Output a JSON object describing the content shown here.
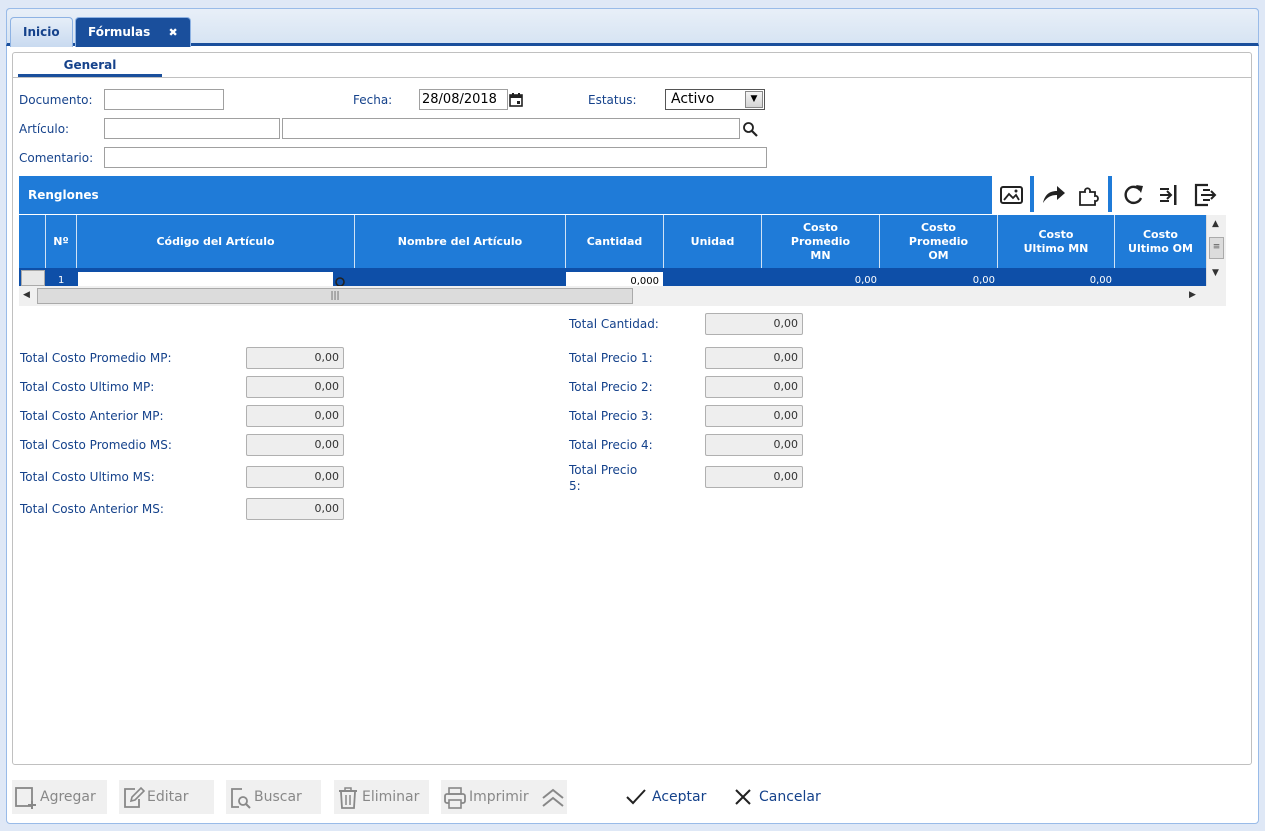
{
  "tabs": [
    {
      "label": "Inicio"
    },
    {
      "label": "Fórmulas",
      "close": "✖"
    }
  ],
  "subtab": {
    "label": "General"
  },
  "form": {
    "documento_label": "Documento:",
    "documento_value": "",
    "fecha_label": "Fecha:",
    "fecha_value": "28/08/2018",
    "estatus_label": "Estatus:",
    "estatus_value": "Activo",
    "articulo_label": "Artículo:",
    "articulo_code": "",
    "articulo_name": "",
    "comentario_label": "Comentario:",
    "comentario_value": ""
  },
  "renglones": {
    "title": "Renglones",
    "columns": [
      "Nº",
      "Código del Artículo",
      "Nombre del Artículo",
      "Cantidad",
      "Unidad",
      "Costo\nPromedio\nMN",
      "Costo\nPromedio\nOM",
      "Costo\nUltimo MN",
      "Costo\nUltimo OM"
    ],
    "row": {
      "num": "1",
      "cantidad": "0,000",
      "costo_prom_mn": "0,00",
      "costo_prom_om": "0,00",
      "costo_ult_mn": "0,00"
    }
  },
  "totals_left": [
    {
      "label": "Total Costo Promedio MP:",
      "value": "0,00"
    },
    {
      "label": "Total Costo Ultimo MP:",
      "value": "0,00"
    },
    {
      "label": "Total Costo Anterior MP:",
      "value": "0,00"
    },
    {
      "label": "Total Costo Promedio MS:",
      "value": "0,00"
    },
    {
      "label": "Total Costo Ultimo MS:",
      "value": "0,00"
    },
    {
      "label": "Total Costo Anterior MS:",
      "value": "0,00"
    }
  ],
  "totals_right": [
    {
      "label": "Total Cantidad:",
      "value": "0,00"
    },
    {
      "label": "Total Precio 1:",
      "value": "0,00"
    },
    {
      "label": "Total Precio 2:",
      "value": "0,00"
    },
    {
      "label": "Total Precio 3:",
      "value": "0,00"
    },
    {
      "label": "Total Precio 4:",
      "value": "0,00"
    },
    {
      "label": "Total Precio\n5:",
      "value": "0,00"
    }
  ],
  "buttons": {
    "agregar": "Agregar",
    "editar": "Editar",
    "buscar": "Buscar",
    "eliminar": "Eliminar",
    "imprimir": "Imprimir",
    "aceptar": "Aceptar",
    "cancelar": "Cancelar"
  },
  "colors": {
    "accent": "#1f7bd8",
    "dark_blue": "#0e4fa8",
    "label": "#15428b"
  }
}
